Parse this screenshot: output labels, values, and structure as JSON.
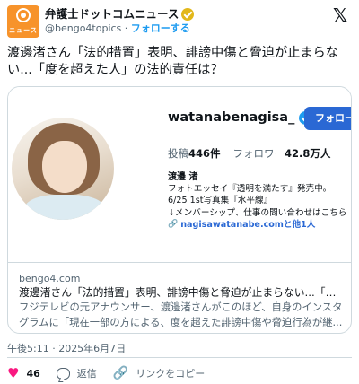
{
  "account": {
    "name": "弁護士ドットコムニュース",
    "avatar_text": "ニュース",
    "handle": "@bengo4topics",
    "separator": "·",
    "follow_label": "フォローする"
  },
  "tweet": {
    "text": "渡邊渚さん「法的措置」表明、誹謗中傷と脅迫が止まらない...「度を超えた人」の法的責任は？"
  },
  "card": {
    "image": {
      "profile_handle": "watanabenagisa_",
      "follow_button": "フォロー",
      "posts_label": "投稿",
      "posts_count": "446件",
      "followers_label": "フォロワー",
      "followers_count": "42.8万人",
      "display_name": "渡邊 渚",
      "bio_lines": [
        "フォトエッセイ『透明を満たす』発売中。",
        "6/25 1st写真集『水平線』",
        "↓メンバーシップ、仕事の問い合わせはこちら"
      ],
      "link_text": "nagisawatanabe.comと他1人"
    },
    "domain": "bengo4.com",
    "title": "渡邊渚さん「法的措置」表明、誹謗中傷と脅迫が止まらない...「度を超...",
    "description": "フジテレビの元アナウンサー、渡邊渚さんがこのほど、自身のインスタグラムに「現在一部の方による、度を超えた誹謗中傷や脅迫行為が継..."
  },
  "timestamp": "午後5:11 · 2025年6月7日",
  "actions": {
    "likes": "46",
    "reply_label": "返信",
    "copy_link_label": "リンクをコピー"
  },
  "colors": {
    "accent_blue": "#1d9bf0",
    "like_pink": "#f91880",
    "brand_orange": "#f7932b"
  }
}
